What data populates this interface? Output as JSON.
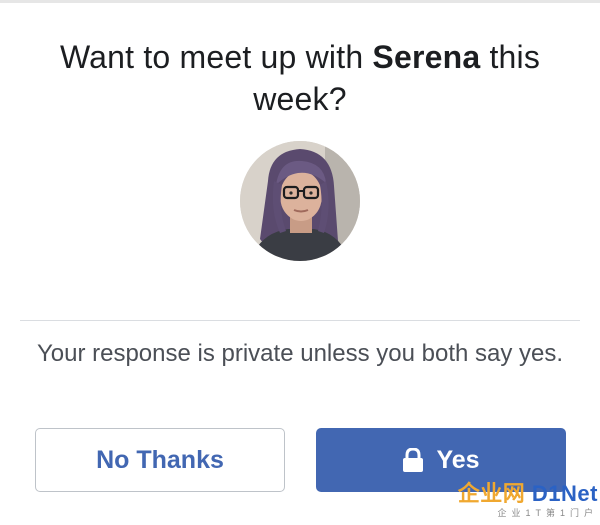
{
  "prompt": {
    "prefix": "Want to meet up with ",
    "name": "Serena",
    "suffix": " this week?"
  },
  "privacy_note": "Your response is private unless you both say yes.",
  "buttons": {
    "decline_label": "No Thanks",
    "accept_label": "Yes",
    "accept_icon": "lock-icon"
  },
  "watermark": {
    "brand_cn": "企业网",
    "brand_en": "D1Net",
    "tagline": "企业1T第1门户"
  },
  "colors": {
    "accent": "#4267b2",
    "text": "#1c1e21",
    "secondary_text": "#4b4f56",
    "divider": "#dadde1"
  }
}
